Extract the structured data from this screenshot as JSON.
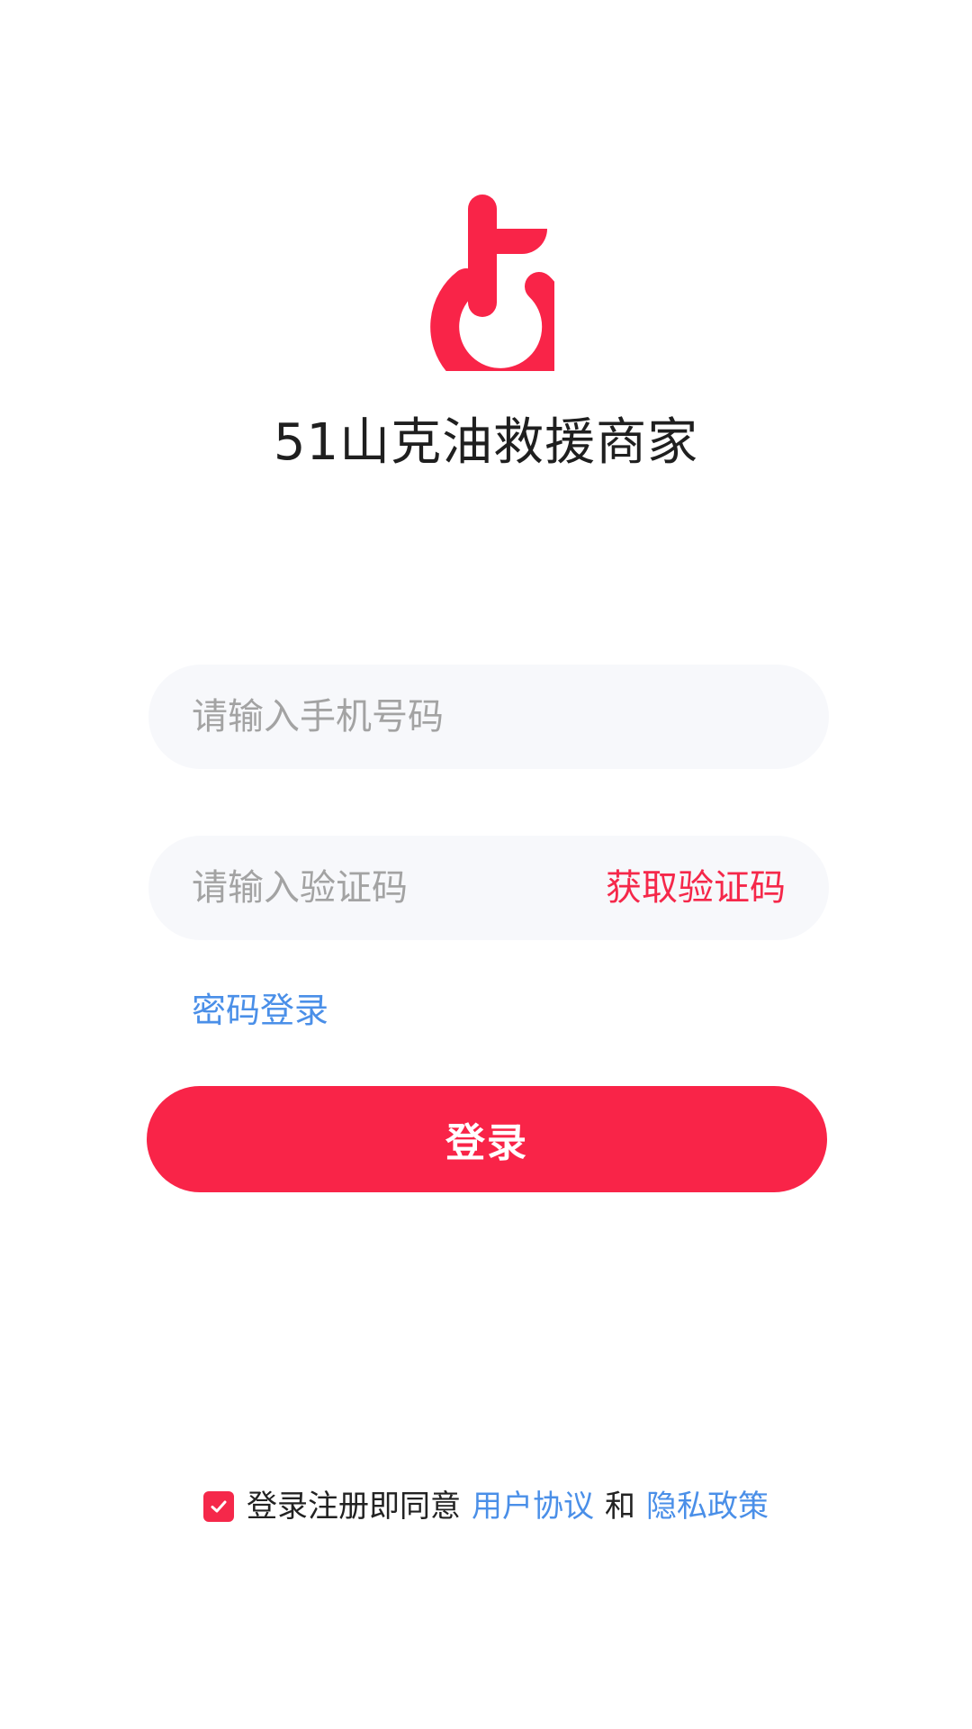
{
  "app": {
    "title": "51山克油救援商家"
  },
  "colors": {
    "brand": "#f92448",
    "link": "#4a8fe8",
    "field_bg": "#f7f8fb"
  },
  "form": {
    "phone_placeholder": "请输入手机号码",
    "code_placeholder": "请输入验证码",
    "get_code_label": "获取验证码",
    "password_login_label": "密码登录",
    "login_label": "登录"
  },
  "agreement": {
    "checked": true,
    "prefix": "登录注册即同意",
    "user_agreement": "用户协议",
    "conjunction": "和",
    "privacy_policy": "隐私政策"
  }
}
